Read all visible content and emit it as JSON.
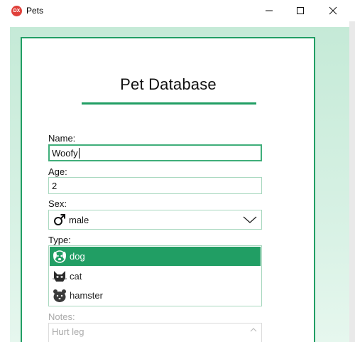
{
  "window": {
    "title": "Pets",
    "icon_text": "DX"
  },
  "form": {
    "heading": "Pet Database",
    "name": {
      "label": "Name:",
      "value": "Woofy"
    },
    "age": {
      "label": "Age:",
      "value": "2"
    },
    "sex": {
      "label": "Sex:",
      "value": "male",
      "icon": "male-symbol-icon"
    },
    "type": {
      "label": "Type:",
      "options": [
        {
          "label": "dog",
          "icon": "dog-icon",
          "selected": true
        },
        {
          "label": "cat",
          "icon": "cat-icon",
          "selected": false
        },
        {
          "label": "hamster",
          "icon": "hamster-icon",
          "selected": false
        }
      ]
    },
    "notes": {
      "label": "Notes:",
      "value": "Hurt leg",
      "disabled": true
    }
  },
  "colors": {
    "accent": "#219e64",
    "field_border": "#a8d8bf",
    "background_tint": "#c5ead7",
    "disabled_text": "#a9a9a9"
  }
}
